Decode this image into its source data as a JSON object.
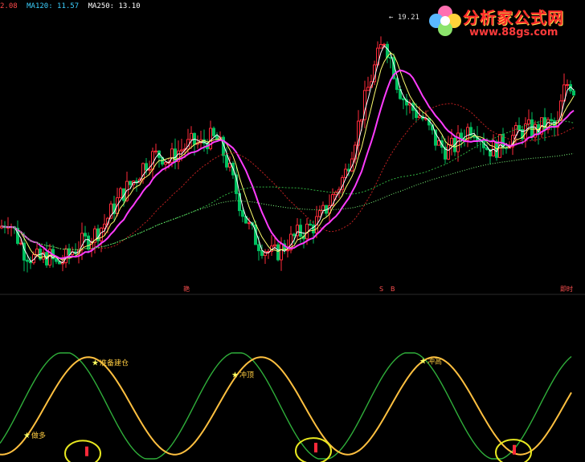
{
  "header": {
    "ma_first": "2.08",
    "ma120": "MA120: 11.57",
    "ma250": "MA250: 13.10"
  },
  "watermark": {
    "title": "分析家公式网",
    "url": "www.88gs.com"
  },
  "colors": {
    "up": "#ff2a3a",
    "down": "#00c060",
    "pink_ma": "#ff3cff",
    "yellow_ma": "#ffff70",
    "white_ma": "#ffffff",
    "osc_green": "#2fae3a",
    "osc_signal": "#ffc040",
    "highlight": "#e8e820",
    "divider": "#2a2a2a"
  },
  "chart_data": [
    {
      "type": "candlestick",
      "peak_label": "19.21",
      "markers": [
        {
          "text": "艳",
          "x_index": 228
        },
        {
          "text": "S",
          "x_index": 472
        },
        {
          "text": "B",
          "x_index": 486
        },
        {
          "text": "即时",
          "x_index": 697
        }
      ],
      "price_curve": [
        [
          0,
          10.8
        ],
        [
          10,
          11.2
        ],
        [
          20,
          10.5
        ],
        [
          30,
          9.8
        ],
        [
          40,
          9.5
        ],
        [
          50,
          9.4
        ],
        [
          60,
          9.6
        ],
        [
          70,
          9.2
        ],
        [
          80,
          9.4
        ],
        [
          90,
          9.8
        ],
        [
          100,
          10.1
        ],
        [
          110,
          10.3
        ],
        [
          120,
          10.6
        ],
        [
          130,
          11.0
        ],
        [
          140,
          11.6
        ],
        [
          150,
          12.2
        ],
        [
          160,
          12.6
        ],
        [
          170,
          13.0
        ],
        [
          180,
          13.6
        ],
        [
          190,
          13.9
        ],
        [
          200,
          14.0
        ],
        [
          210,
          13.7
        ],
        [
          220,
          14.1
        ],
        [
          230,
          14.3
        ],
        [
          240,
          14.5
        ],
        [
          250,
          14.4
        ],
        [
          260,
          14.7
        ],
        [
          270,
          14.6
        ],
        [
          280,
          13.9
        ],
        [
          290,
          12.8
        ],
        [
          300,
          11.7
        ],
        [
          310,
          10.8
        ],
        [
          320,
          10.2
        ],
        [
          330,
          9.9
        ],
        [
          340,
          9.6
        ],
        [
          350,
          9.9
        ],
        [
          360,
          10.2
        ],
        [
          370,
          10.5
        ],
        [
          380,
          10.7
        ],
        [
          390,
          10.9
        ],
        [
          400,
          11.3
        ],
        [
          410,
          11.9
        ],
        [
          420,
          12.5
        ],
        [
          430,
          13.2
        ],
        [
          440,
          14.5
        ],
        [
          450,
          15.8
        ],
        [
          460,
          17.1
        ],
        [
          470,
          18.2
        ],
        [
          478,
          19.0
        ],
        [
          485,
          18.3
        ],
        [
          495,
          17.0
        ],
        [
          505,
          16.2
        ],
        [
          515,
          15.9
        ],
        [
          525,
          15.6
        ],
        [
          535,
          15.0
        ],
        [
          545,
          14.4
        ],
        [
          555,
          14.2
        ],
        [
          565,
          14.3
        ],
        [
          575,
          14.8
        ],
        [
          585,
          15.2
        ],
        [
          595,
          15.0
        ],
        [
          605,
          14.3
        ],
        [
          615,
          14.2
        ],
        [
          625,
          14.5
        ],
        [
          635,
          14.7
        ],
        [
          645,
          14.9
        ],
        [
          655,
          15.1
        ],
        [
          665,
          15.0
        ],
        [
          675,
          15.2
        ],
        [
          685,
          15.3
        ],
        [
          693,
          15.0
        ],
        [
          700,
          16.6
        ],
        [
          708,
          17.2
        ],
        [
          714,
          16.8
        ]
      ]
    },
    {
      "type": "line",
      "annotations": [
        {
          "text": "做多",
          "x_index": 37
        },
        {
          "text": "准备建仓",
          "x_index": 122
        },
        {
          "text": "冲顶",
          "x_index": 296
        },
        {
          "text": "冲高",
          "x_index": 530
        }
      ],
      "signals": [
        {
          "x_index": 108,
          "value": -0.95
        },
        {
          "x_index": 393,
          "value": -0.88
        },
        {
          "x_index": 640,
          "value": -0.92
        }
      ],
      "highlight_rings": [
        {
          "x_index": 103,
          "value": -0.9
        },
        {
          "x_index": 390,
          "value": -0.85
        },
        {
          "x_index": 639,
          "value": -0.88
        }
      ]
    }
  ]
}
